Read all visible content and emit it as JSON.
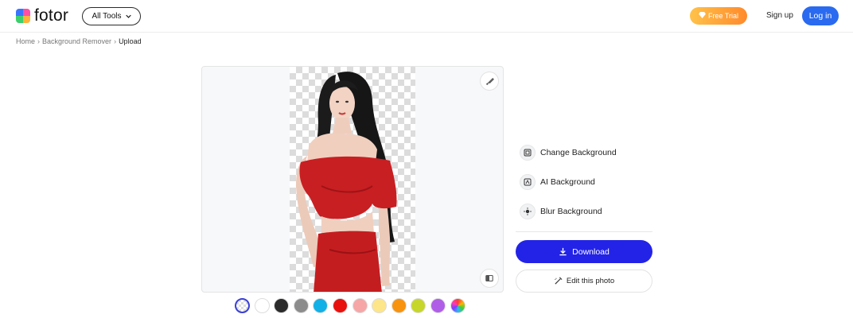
{
  "header": {
    "logo_text": "fotor",
    "all_tools_label": "All Tools",
    "free_trial_label": "Free Trial",
    "signup_label": "Sign up",
    "login_label": "Log in"
  },
  "breadcrumb": {
    "items": [
      "Home",
      "Background Remover",
      "Upload"
    ]
  },
  "canvas": {
    "image": "woman-in-red-outfit-cutout",
    "brush_icon": "brush-icon",
    "compare_icon": "compare-icon"
  },
  "swatches": [
    {
      "name": "transparent",
      "color": "transparent",
      "selected": true
    },
    {
      "name": "white",
      "color": "#ffffff"
    },
    {
      "name": "black",
      "color": "#2b2b2b"
    },
    {
      "name": "gray",
      "color": "#8c8c8c"
    },
    {
      "name": "sky-blue",
      "color": "#11b0e6"
    },
    {
      "name": "red",
      "color": "#e8110e"
    },
    {
      "name": "pink",
      "color": "#f6a6a6"
    },
    {
      "name": "light-yellow",
      "color": "#fde58a"
    },
    {
      "name": "orange",
      "color": "#f7930f"
    },
    {
      "name": "lime",
      "color": "#c6d62a"
    },
    {
      "name": "purple",
      "color": "#b05ee8"
    },
    {
      "name": "custom",
      "color": "rainbow"
    }
  ],
  "options": [
    {
      "label": "Change Background",
      "icon": "change-background-icon"
    },
    {
      "label": "AI Background",
      "icon": "ai-background-icon"
    },
    {
      "label": "Blur Background",
      "icon": "blur-background-icon"
    }
  ],
  "actions": {
    "download_label": "Download",
    "edit_label": "Edit this photo"
  },
  "colors": {
    "login_blue": "#2a6af0",
    "download_blue": "#2323e8",
    "free_trial_orange": "#ff9a2e"
  }
}
